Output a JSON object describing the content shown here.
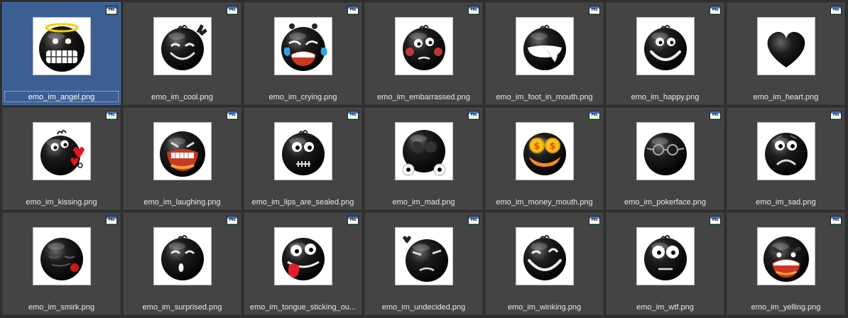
{
  "badge_text": "PNG",
  "colors": {
    "background": "#2f2f2f",
    "tile": "#444444",
    "tile_selected": "#3b5f93",
    "label": "#e8e8e8"
  },
  "selected_index": 0,
  "files": [
    {
      "name": "emo_im_angel.png",
      "icon": "angel-emoticon-icon"
    },
    {
      "name": "emo_im_cool.png",
      "icon": "cool-emoticon-icon"
    },
    {
      "name": "emo_im_crying.png",
      "icon": "crying-emoticon-icon"
    },
    {
      "name": "emo_im_embarrassed.png",
      "icon": "embarrassed-emoticon-icon"
    },
    {
      "name": "emo_im_foot_in_mouth.png",
      "icon": "foot-in-mouth-emoticon-icon"
    },
    {
      "name": "emo_im_happy.png",
      "icon": "happy-emoticon-icon"
    },
    {
      "name": "emo_im_heart.png",
      "icon": "heart-emoticon-icon"
    },
    {
      "name": "emo_im_kissing.png",
      "icon": "kissing-emoticon-icon"
    },
    {
      "name": "emo_im_laughing.png",
      "icon": "laughing-emoticon-icon"
    },
    {
      "name": "emo_im_lips_are_sealed.png",
      "icon": "lips-sealed-emoticon-icon"
    },
    {
      "name": "emo_im_mad.png",
      "icon": "mad-emoticon-icon"
    },
    {
      "name": "emo_im_money_mouth.png",
      "icon": "money-mouth-emoticon-icon"
    },
    {
      "name": "emo_im_pokerface.png",
      "icon": "pokerface-emoticon-icon"
    },
    {
      "name": "emo_im_sad.png",
      "icon": "sad-emoticon-icon"
    },
    {
      "name": "emo_im_smirk.png",
      "icon": "smirk-emoticon-icon"
    },
    {
      "name": "emo_im_surprised.png",
      "icon": "surprised-emoticon-icon"
    },
    {
      "name": "emo_im_tongue_sticking_ou...",
      "icon": "tongue-emoticon-icon"
    },
    {
      "name": "emo_im_undecided.png",
      "icon": "undecided-emoticon-icon"
    },
    {
      "name": "emo_im_winking.png",
      "icon": "winking-emoticon-icon"
    },
    {
      "name": "emo_im_wtf.png",
      "icon": "wtf-emoticon-icon"
    },
    {
      "name": "emo_im_yelling.png",
      "icon": "yelling-emoticon-icon"
    }
  ]
}
